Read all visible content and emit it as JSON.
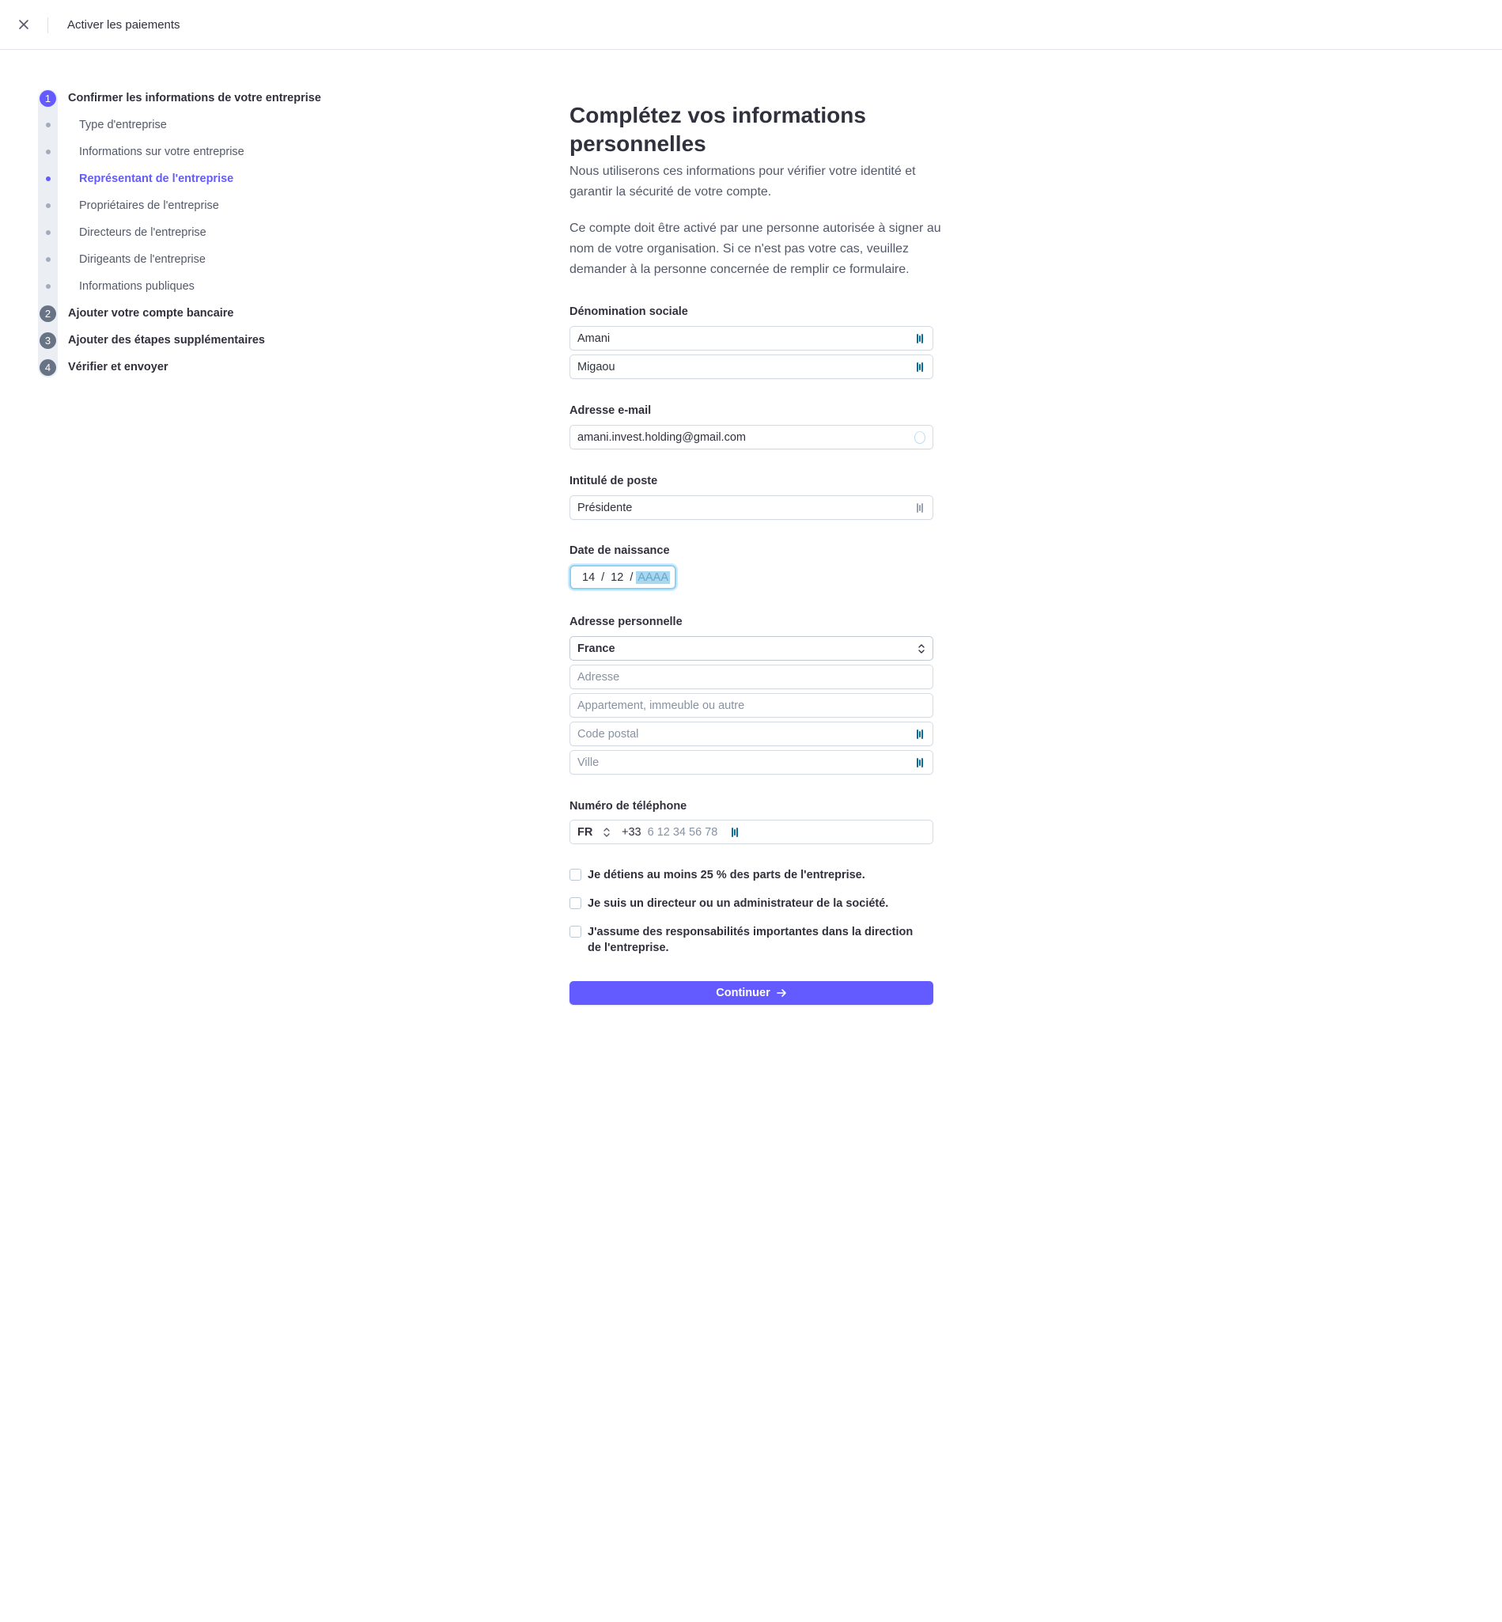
{
  "topbar": {
    "title": "Activer les paiements",
    "close_icon": "close-icon"
  },
  "stepper": {
    "steps": [
      {
        "number": "1",
        "label": "Confirmer les informations de votre entreprise",
        "state": "active",
        "substeps": [
          {
            "label": "Type d'entreprise",
            "state": "default"
          },
          {
            "label": "Informations sur votre entreprise",
            "state": "default"
          },
          {
            "label": "Représentant de l'entreprise",
            "state": "current"
          },
          {
            "label": "Propriétaires de l'entreprise",
            "state": "default"
          },
          {
            "label": "Directeurs de l'entreprise",
            "state": "default"
          },
          {
            "label": "Dirigeants de l'entreprise",
            "state": "default"
          },
          {
            "label": "Informations publiques",
            "state": "default"
          }
        ]
      },
      {
        "number": "2",
        "label": "Ajouter votre compte bancaire",
        "state": "pending"
      },
      {
        "number": "3",
        "label": "Ajouter des étapes supplémentaires",
        "state": "pending"
      },
      {
        "number": "4",
        "label": "Vérifier et envoyer",
        "state": "pending"
      }
    ]
  },
  "form": {
    "title": "Complétez vos informations personnelles",
    "intro_1": "Nous utiliserons ces informations pour vérifier votre identité et garantir la sécurité de votre compte.",
    "intro_2": "Ce compte doit être activé par une personne autorisée à signer au nom de votre organisation. Si ce n'est pas votre cas, veuillez demander à la personne concernée de remplir ce formulaire.",
    "legal_name": {
      "label": "Dénomination sociale",
      "first_name": "Amani",
      "last_name": "Migaou"
    },
    "email": {
      "label": "Adresse e-mail",
      "value": "amani.invest.holding@gmail.com"
    },
    "job_title": {
      "label": "Intitulé de poste",
      "value": "Présidente"
    },
    "dob": {
      "label": "Date de naissance",
      "day": "14",
      "month": "12",
      "year_placeholder": "AAAA",
      "sep": "/"
    },
    "address": {
      "label": "Adresse personnelle",
      "country": "France",
      "line1_placeholder": "Adresse",
      "line2_placeholder": "Appartement, immeuble ou autre",
      "postal_placeholder": "Code postal",
      "city_placeholder": "Ville"
    },
    "phone": {
      "label": "Numéro de téléphone",
      "country_code": "FR",
      "prefix": "+33",
      "placeholder": "6 12 34 56 78"
    },
    "checkboxes": [
      {
        "label": "Je détiens au moins 25 % des parts de l'entreprise.",
        "checked": false
      },
      {
        "label": "Je suis un directeur ou un administrateur de la société.",
        "checked": false
      },
      {
        "label": "J'assume des responsabilités importantes dans la direction de l'entreprise.",
        "checked": false
      }
    ],
    "continue_label": "Continuer"
  },
  "colors": {
    "accent": "#635bff",
    "autofill_icon": "#0b6e99"
  }
}
